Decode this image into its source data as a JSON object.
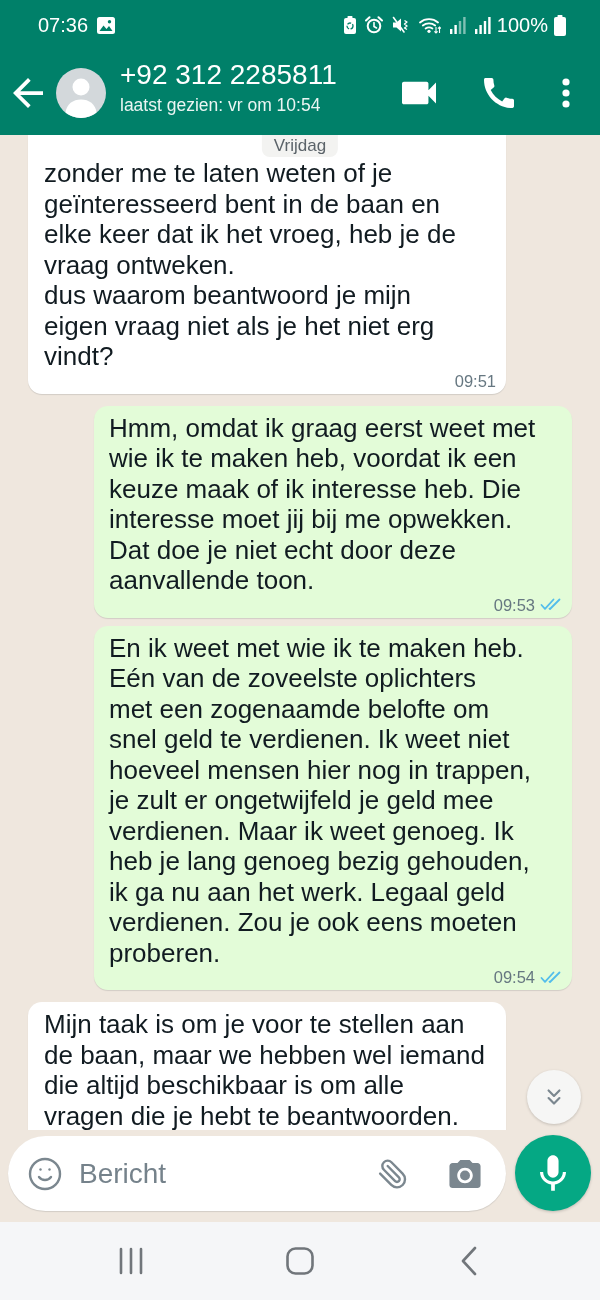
{
  "status_bar": {
    "time": "07:36",
    "battery": "100%"
  },
  "header": {
    "name": "+92 312 2285811",
    "last_seen": "laatst gezien: vr om 10:54"
  },
  "chat": {
    "date_divider": "Vrijdag",
    "messages": [
      {
        "kind": "incoming",
        "text": "zonder me te laten weten of je\ngeïnteresseerd bent in de baan en\nelke keer dat ik het vroeg, heb je de\nvraag ontweken.\ndus waarom beantwoord je mijn\neigen vraag niet als je het niet erg\nvindt?",
        "time": "09:51"
      },
      {
        "kind": "outgoing",
        "text": "Hmm, omdat ik graag eerst weet met\nwie ik te maken heb, voordat ik een\nkeuze maak of ik interesse heb. Die\ninteresse moet jij bij me opwekken.\nDat doe je niet echt door deze\naanvallende toon.",
        "time": "09:53",
        "read": true
      },
      {
        "kind": "outgoing",
        "text": "En ik weet met wie ik te maken heb.\nEén van de zoveelste oplichters\nmet een zogenaamde belofte om\nsnel geld te verdienen. Ik weet niet\nhoeveel mensen hier nog in trappen,\nje zult er ongetwijfeld je geld mee\nverdienen. Maar ik weet genoeg. Ik\nheb je lang genoeg bezig gehouden,\nik ga nu aan het werk. Legaal geld\nverdienen. Zou je ook eens moeten\nproberen.",
        "time": "09:54",
        "read": true
      },
      {
        "kind": "incoming",
        "text": "Mijn taak is om je voor te stellen aan\nde baan, maar we hebben wel iemand\ndie altijd beschikbaar is om alle\nvragen die je hebt te beantwoorden."
      }
    ]
  },
  "composer": {
    "placeholder": "Bericht"
  }
}
